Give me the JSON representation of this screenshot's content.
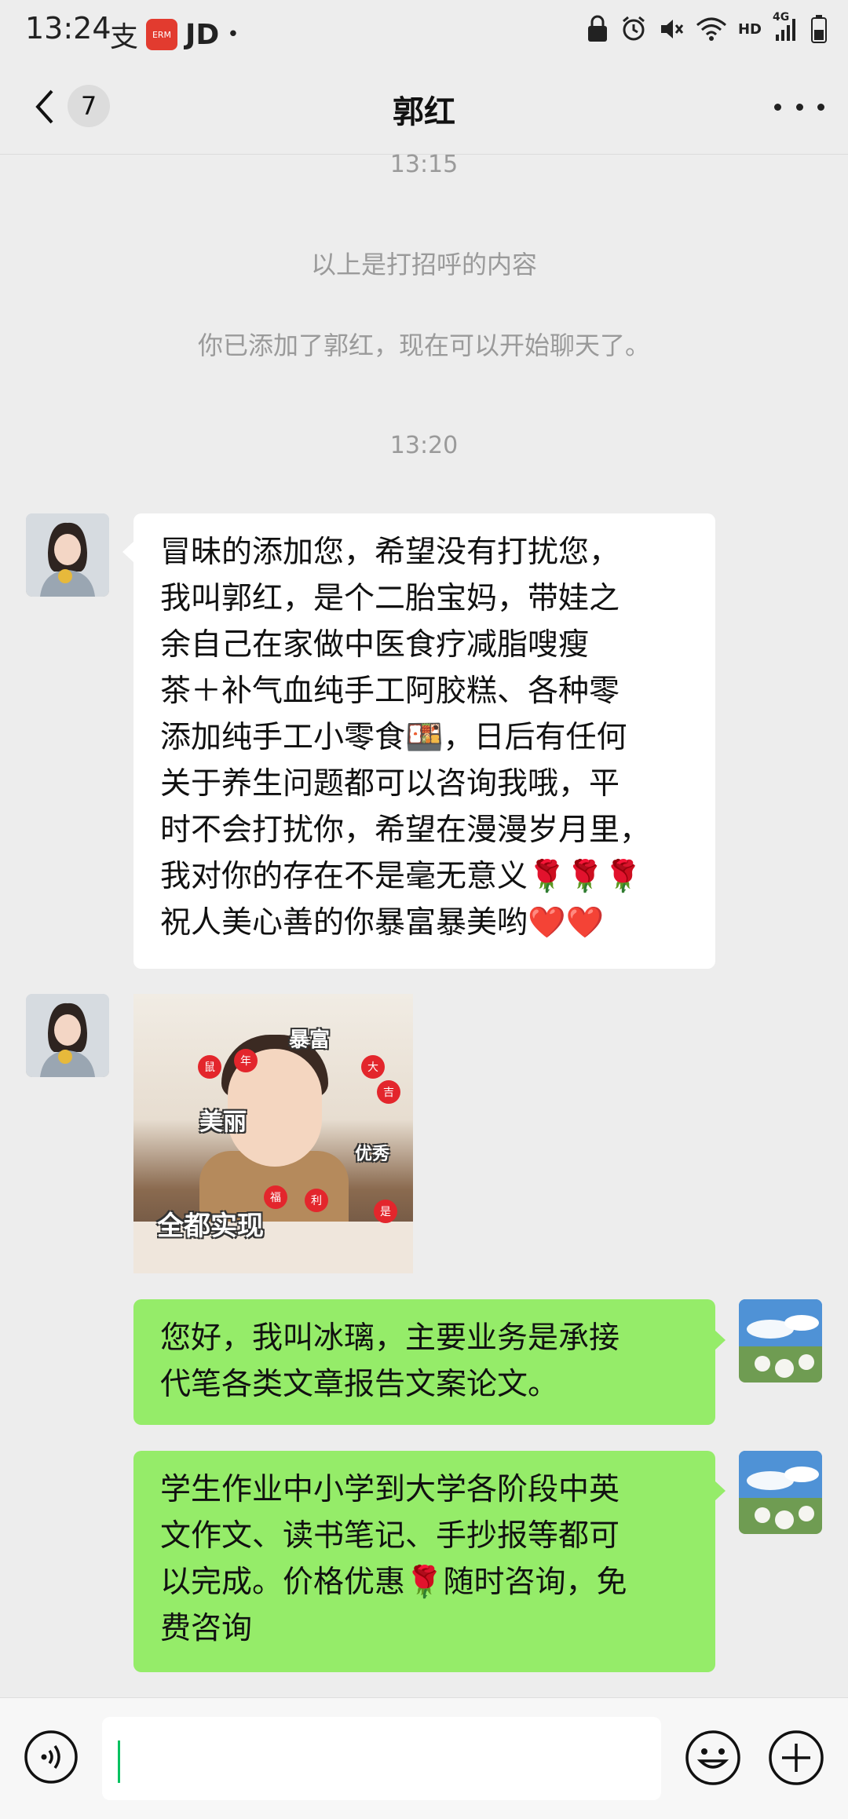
{
  "status_bar": {
    "time": "13:24",
    "alipay_glyph": "支",
    "jd_label": "JD",
    "dot": "•",
    "hd_label": "HD",
    "network_label": "4G",
    "icons": [
      "lock-icon",
      "alarm-icon",
      "mute-icon",
      "wifi-icon",
      "signal-icon",
      "battery-icon"
    ]
  },
  "header": {
    "back_icon": "chevron-left-icon",
    "unread_count": "7",
    "title": "郭红",
    "more_icon": "more-dots-icon"
  },
  "messages": {
    "timestamp_1": "13:15",
    "system_1": "以上是打招呼的内容",
    "system_2": "你已添加了郭红，现在可以开始聊天了。",
    "timestamp_2": "13:20",
    "incoming_1_lines": [
      "冒昧的添加您，希望没有打扰您，",
      "我叫郭红，是个二胎宝妈，带娃之",
      "余自己在家做中医食疗减脂嗖瘦",
      "茶＋补气血纯手工阿胶糕、各种零",
      "添加纯手工小零食🍱，日后有任何",
      "关于养生问题都可以咨询我哦，平",
      "时不会打扰你，希望在漫漫岁月里，",
      "我对你的存在不是毫无意义🌹🌹🌹",
      "祝人美心善的你暴富暴美哟❤️❤️"
    ],
    "sticker": {
      "captions": [
        "暴富",
        "美丽",
        "优秀",
        "全都实现"
      ],
      "small_marks": [
        "鼠",
        "年",
        "大",
        "吉",
        "福",
        "利",
        "是"
      ]
    },
    "outgoing_1_lines": [
      "您好，我叫冰璃，主要业务是承接",
      "代笔各类文章报告文案论文。"
    ],
    "outgoing_2_lines": [
      "学生作业中小学到大学各阶段中英",
      "文作文、读书笔记、手抄报等都可",
      "以完成。价格优惠🌹随时咨询，免",
      "费咨询"
    ]
  },
  "input_bar": {
    "voice_icon": "voice-icon",
    "text_value": "",
    "emoji_icon": "emoji-smile-icon",
    "plus_icon": "plus-circle-icon"
  },
  "colors": {
    "background": "#ededed",
    "incoming_bubble": "#ffffff",
    "outgoing_bubble": "#95ec69",
    "system_text": "#9a9a9a",
    "caret": "#07c160"
  }
}
